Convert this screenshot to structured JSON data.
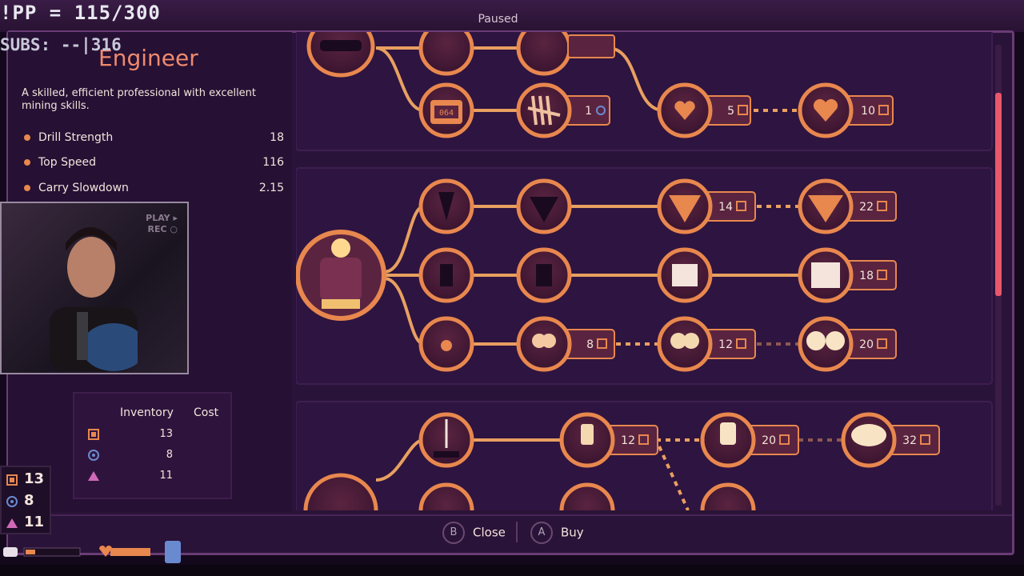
{
  "game": {
    "paused_label": "Paused",
    "class_title": "Engineer",
    "description": "A skilled, efficient professional with excellent mining skills.",
    "stats": [
      {
        "label": "Drill Strength",
        "value": "18"
      },
      {
        "label": "Top Speed",
        "value": "116"
      },
      {
        "label": "Carry Slowdown",
        "value": "2.15"
      }
    ],
    "inventory": {
      "col_inventory": "Inventory",
      "col_cost": "Cost",
      "rows": [
        {
          "icon": "iron-cube-icon",
          "inventory": "13"
        },
        {
          "icon": "water-orb-icon",
          "inventory": "8"
        },
        {
          "icon": "cobalt-triangle-icon",
          "inventory": "11"
        }
      ]
    },
    "resources_hud": [
      {
        "icon": "iron-cube-icon",
        "value": "13"
      },
      {
        "icon": "water-orb-icon",
        "value": "8"
      },
      {
        "icon": "cobalt-triangle-icon",
        "value": "11"
      }
    ],
    "buttons": {
      "close_badge": "B",
      "close_label": "Close",
      "buy_badge": "A",
      "buy_label": "Buy"
    },
    "tree": {
      "top_row_prices": [
        {
          "value": "1",
          "icon": "water-orb-icon"
        },
        {
          "value": "5",
          "icon": "iron-cube-icon"
        },
        {
          "value": "10",
          "icon": "iron-cube-icon"
        }
      ],
      "drill_row_prices": [
        "14",
        "22"
      ],
      "speed_row_prices": [
        "18"
      ],
      "carry_row_prices": [
        "8",
        "12",
        "20"
      ],
      "lamp_row_prices": [
        "12",
        "20",
        "32"
      ],
      "counter_label": "064"
    },
    "colors": {
      "accent": "#f08a6e",
      "node": "#e8874e",
      "panel": "#2a1338"
    }
  },
  "stream_overlay": {
    "counter": "!PP = 115/300",
    "subs": "SUBS: --|316",
    "cam_badge_1": "PLAY ▸",
    "cam_badge_2": "REC ○"
  }
}
